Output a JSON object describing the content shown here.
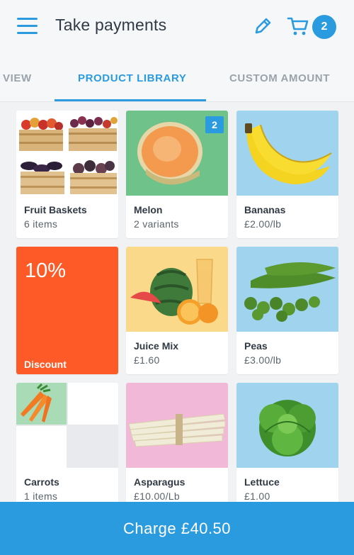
{
  "header": {
    "title": "Take payments",
    "cart_count": "2",
    "accent": "#2b9be0"
  },
  "tabs": [
    {
      "label": "VIEW",
      "active": false
    },
    {
      "label": "PRODUCT LIBRARY",
      "active": true
    },
    {
      "label": "CUSTOM AMOUNT",
      "active": false
    }
  ],
  "products": [
    {
      "name": "Fruit Baskets",
      "sub": "6 items",
      "icon": "fruit-baskets-image"
    },
    {
      "name": "Melon",
      "sub": "2 variants",
      "badge": "2",
      "icon": "melon-image"
    },
    {
      "name": "Bananas",
      "sub": "£2.00/lb",
      "icon": "banana-image"
    },
    {
      "name": "Discount",
      "percent": "10%",
      "color": "#fe5a28"
    },
    {
      "name": "Juice Mix",
      "sub": "£1.60",
      "icon": "juice-mix-image"
    },
    {
      "name": "Peas",
      "sub": "£3.00/lb",
      "icon": "peas-image"
    },
    {
      "name": "Carrots",
      "sub": "1 items",
      "icon": "carrots-image"
    },
    {
      "name": "Asparagus",
      "sub": "£10.00/Lb",
      "icon": "asparagus-image"
    },
    {
      "name": "Lettuce",
      "sub": "£1.00",
      "icon": "lettuce-image"
    }
  ],
  "charge": {
    "label": "Charge £40.50"
  }
}
